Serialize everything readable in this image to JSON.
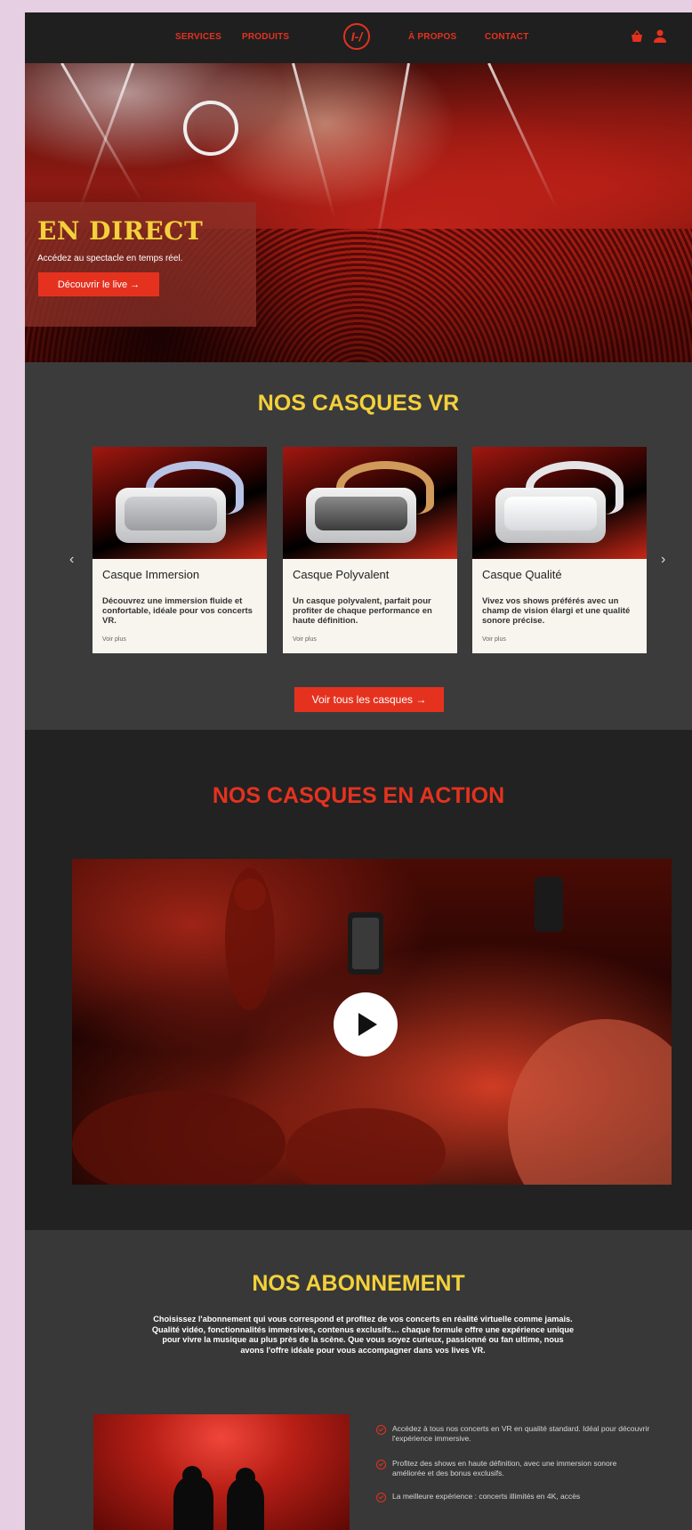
{
  "nav": {
    "links": [
      "SERVICES",
      "PRODUITS",
      "À PROPOS",
      "CONTACT"
    ],
    "logo_text": "I-/",
    "icons": [
      "basket-icon",
      "user-icon"
    ]
  },
  "hero": {
    "title": "EN DIRECT",
    "subtitle": "Accédez au spectacle en temps réel.",
    "button": "Découvrir le live →"
  },
  "vr": {
    "title": "NOS CASQUES VR",
    "cards": [
      {
        "name": "Casque Immersion",
        "desc": "Découvrez une immersion fluide et confortable, idéale pour vos concerts VR.",
        "more": "Voir plus"
      },
      {
        "name": "Casque Polyvalent",
        "desc": "Un casque polyvalent, parfait pour profiter de chaque performance en haute définition.",
        "more": "Voir plus"
      },
      {
        "name": "Casque Qualité",
        "desc": "Vivez vos shows préférés avec un champ de vision élargi et une qualité sonore précise.",
        "more": "Voir plus"
      }
    ],
    "prev": "‹",
    "next": "›",
    "button": "Voir tous les casques →"
  },
  "action": {
    "title": "NOS CASQUES EN ACTION"
  },
  "subscription": {
    "title": "NOS ABONNEMENT",
    "text": "Choisissez l'abonnement qui vous correspond et profitez de vos concerts en réalité virtuelle comme jamais. Qualité vidéo, fonctionnalités immersives, contenus exclusifs… chaque formule offre une expérience unique pour vivre la musique au plus près de la scène. Que vous soyez curieux, passionné ou fan ultime, nous avons l'offre idéale pour vous accompagner dans vos lives VR.",
    "features": [
      "Accédez à tous nos concerts en VR en qualité standard. Idéal pour découvrir l'expérience immersive.",
      "Profitez des shows en haute définition, avec une immersion sonore améliorée et des bonus exclusifs.",
      "La meilleure expérience : concerts illimités en 4K, accès"
    ]
  },
  "colors": {
    "accent": "#e5321f",
    "gold": "#f4d13a",
    "background_outer": "#e6cfe2",
    "nav_bg": "#1f1f1f"
  }
}
